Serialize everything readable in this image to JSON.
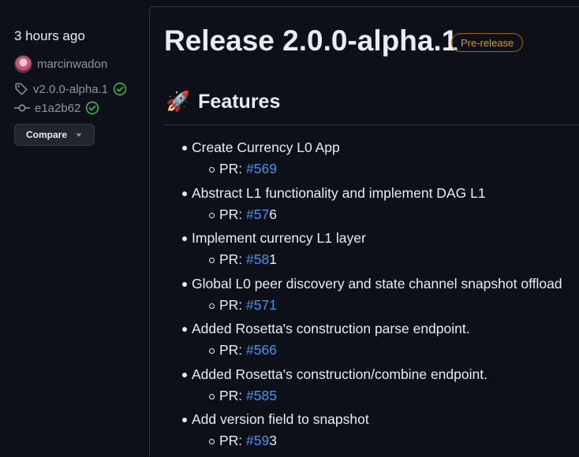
{
  "sidebar": {
    "time": "3 hours ago",
    "author": "marcinwadon",
    "tag": "v2.0.0-alpha.1",
    "commit": "e1a2b62",
    "compare_label": "Compare"
  },
  "release": {
    "title": "Release 2.0.0-alpha.1",
    "badge": "Pre-release"
  },
  "section": {
    "heading": "Features"
  },
  "features": [
    {
      "text": "Create Currency L0 App",
      "pr_prefix": "PR: ",
      "pr_link": "#569",
      "pr_after": ""
    },
    {
      "text": "Abstract L1 functionality and implement DAG L1",
      "pr_prefix": "PR: ",
      "pr_link": "#57",
      "pr_after": "6"
    },
    {
      "text": "Implement currency L1 layer",
      "pr_prefix": "PR: ",
      "pr_link": "#58",
      "pr_after": "1"
    },
    {
      "text": "Global L0 peer discovery and state channel snapshot offload",
      "pr_prefix": "PR: ",
      "pr_link": "#571",
      "pr_after": ""
    },
    {
      "text": "Added Rosetta's construction parse endpoint.",
      "pr_prefix": "PR: ",
      "pr_link": "#566",
      "pr_after": ""
    },
    {
      "text": "Added Rosetta's construction/combine endpoint.",
      "pr_prefix": "PR: ",
      "pr_link": "#585",
      "pr_after": ""
    },
    {
      "text": "Add version field to snapshot",
      "pr_prefix": "PR: ",
      "pr_link": "#59",
      "pr_after": "3"
    }
  ],
  "colors": {
    "background": "#0d1117",
    "text": "#e6edf3",
    "muted": "#8d96a0",
    "link": "#4493f8",
    "prerelease": "#d29922",
    "verified": "#3fb950"
  },
  "icons": {
    "tag": "tag-icon",
    "commit": "git-commit-icon",
    "verified": "verified-check-icon",
    "dropdown": "triangle-down-icon",
    "rocket": "rocket-icon"
  }
}
